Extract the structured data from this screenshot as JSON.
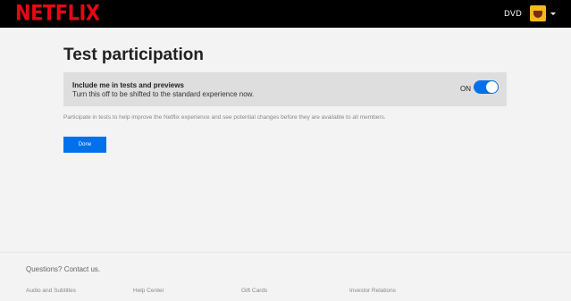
{
  "header": {
    "logo_text": "NETFLIX",
    "profile_name": "DVD",
    "avatar_icon": "smiley-face-avatar",
    "dropdown_icon": "caret-down-icon"
  },
  "page": {
    "title": "Test participation"
  },
  "setting": {
    "title": "Include me in tests and previews",
    "description": "Turn this off to be shifted to the standard experience now.",
    "toggle_label": "ON",
    "toggle_on": true
  },
  "help_text": "Participate in tests to help improve the Netflix experience and see potential changes before they are available to all members.",
  "done_label": "Done",
  "footer": {
    "contact": "Questions? Contact us.",
    "links": [
      "Audio and Subtitles",
      "Help Center",
      "Gift Cards",
      "Investor Relations"
    ]
  },
  "colors": {
    "brand_red": "#e50914",
    "accent_blue": "#0071eb",
    "background": "#f3f3f3",
    "topbar": "#000000"
  }
}
